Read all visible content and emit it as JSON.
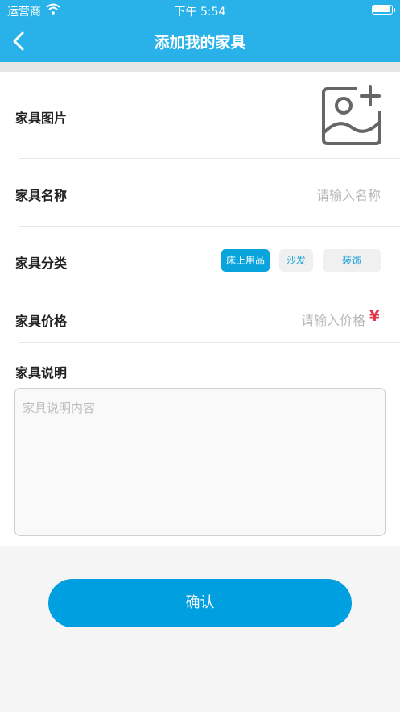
{
  "status_bar": {
    "carrier": "运营商",
    "time": "下午 5:54"
  },
  "header": {
    "title": "添加我的家具",
    "back_icon": "chevron-left-icon"
  },
  "form": {
    "photo": {
      "label": "家具图片",
      "icon": "add-image-icon"
    },
    "name": {
      "label": "家具名称",
      "placeholder": "请输入名称"
    },
    "category": {
      "label": "家具分类",
      "options": [
        {
          "label": "床上用品",
          "selected": true
        },
        {
          "label": "沙发",
          "selected": false
        },
        {
          "label": "装饰",
          "selected": false
        }
      ]
    },
    "price": {
      "label": "家具价格",
      "placeholder": "请输入价格",
      "currency": "¥"
    },
    "description": {
      "label": "家具说明",
      "placeholder": "家具说明内容"
    }
  },
  "confirm_label": "确认",
  "colors": {
    "header": "#29b2e9",
    "accent": "#009fdf",
    "price_symbol": "#e3344c"
  }
}
